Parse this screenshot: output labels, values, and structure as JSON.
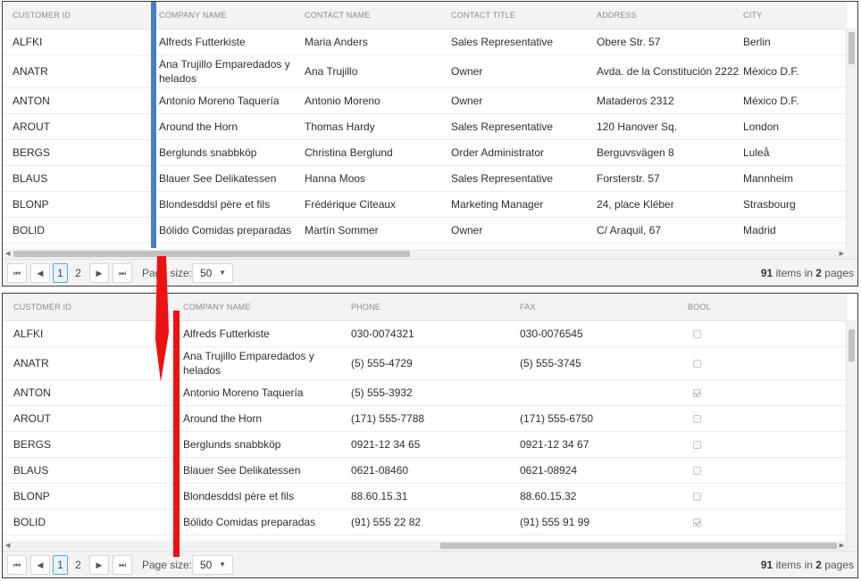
{
  "grid1": {
    "columns": [
      "CUSTOMER ID",
      "COMPANY NAME",
      "CONTACT NAME",
      "CONTACT TITLE",
      "ADDRESS",
      "CITY"
    ],
    "rows": [
      [
        "ALFKI",
        "Alfreds Futterkiste",
        "Maria Anders",
        "Sales Representative",
        "Obere Str. 57",
        "Berlin"
      ],
      [
        "ANATR",
        "Ana Trujillo Emparedados y helados",
        "Ana Trujillo",
        "Owner",
        "Avda. de la Constitución 2222",
        "México D.F."
      ],
      [
        "ANTON",
        "Antonio Moreno Taquería",
        "Antonio Moreno",
        "Owner",
        "Mataderos 2312",
        "México D.F."
      ],
      [
        "AROUT",
        "Around the Horn",
        "Thomas Hardy",
        "Sales Representative",
        "120 Hanover Sq.",
        "London"
      ],
      [
        "BERGS",
        "Berglunds snabbköp",
        "Christina Berglund",
        "Order Administrator",
        "Berguvsvägen 8",
        "Luleå"
      ],
      [
        "BLAUS",
        "Blauer See Delikatessen",
        "Hanna Moos",
        "Sales Representative",
        "Forsterstr. 57",
        "Mannheim"
      ],
      [
        "BLONP",
        "Blondesddsl père et fils",
        "Frédérique Citeaux",
        "Marketing Manager",
        "24, place Kléber",
        "Strasbourg"
      ],
      [
        "BOLID",
        "Bólido Comidas preparadas",
        "Martín Sommer",
        "Owner",
        "C/ Araquil, 67",
        "Madrid"
      ]
    ],
    "pager": {
      "pages": [
        "1",
        "2"
      ],
      "page_size_label": "Page size:",
      "page_size": "50",
      "total_items": "91",
      "items_in_text": "items in",
      "total_pages": "2",
      "pages_text": "pages"
    }
  },
  "grid2": {
    "columns": [
      "CUSTOMER ID",
      "COMPANY NAME",
      "PHONE",
      "FAX",
      "BOOL"
    ],
    "rows": [
      [
        "ALFKI",
        "Alfreds Futterkiste",
        "030-0074321",
        "030-0076545",
        false
      ],
      [
        "ANATR",
        "Ana Trujillo Emparedados y helados",
        "(5) 555-4729",
        "(5) 555-3745",
        false
      ],
      [
        "ANTON",
        "Antonio Moreno Taquería",
        "(5) 555-3932",
        "",
        true
      ],
      [
        "AROUT",
        "Around the Horn",
        "(171) 555-7788",
        "(171) 555-6750",
        false
      ],
      [
        "BERGS",
        "Berglunds snabbköp",
        "0921-12 34 65",
        "0921-12 34 67",
        false
      ],
      [
        "BLAUS",
        "Blauer See Delikatessen",
        "0621-08460",
        "0621-08924",
        false
      ],
      [
        "BLONP",
        "Blondesddsl père et fils",
        "88.60.15.31",
        "88.60.15.32",
        false
      ],
      [
        "BOLID",
        "Bólido Comidas preparadas",
        "(91) 555 22 82",
        "(91) 555 91 99",
        true
      ]
    ],
    "pager": {
      "pages": [
        "1",
        "2"
      ],
      "page_size_label": "Page size:",
      "page_size": "50",
      "total_items": "91",
      "items_in_text": "items in",
      "total_pages": "2",
      "pages_text": "pages"
    }
  },
  "icons": {
    "first": "first-page-icon",
    "prev": "previous-page-icon",
    "next": "next-page-icon",
    "last": "last-page-icon",
    "dropdown": "chevron-down-icon"
  },
  "colors": {
    "column_marker_blue": "#4a7fc1",
    "column_marker_red": "#ee1111",
    "active_page": "#5aa7d6"
  }
}
